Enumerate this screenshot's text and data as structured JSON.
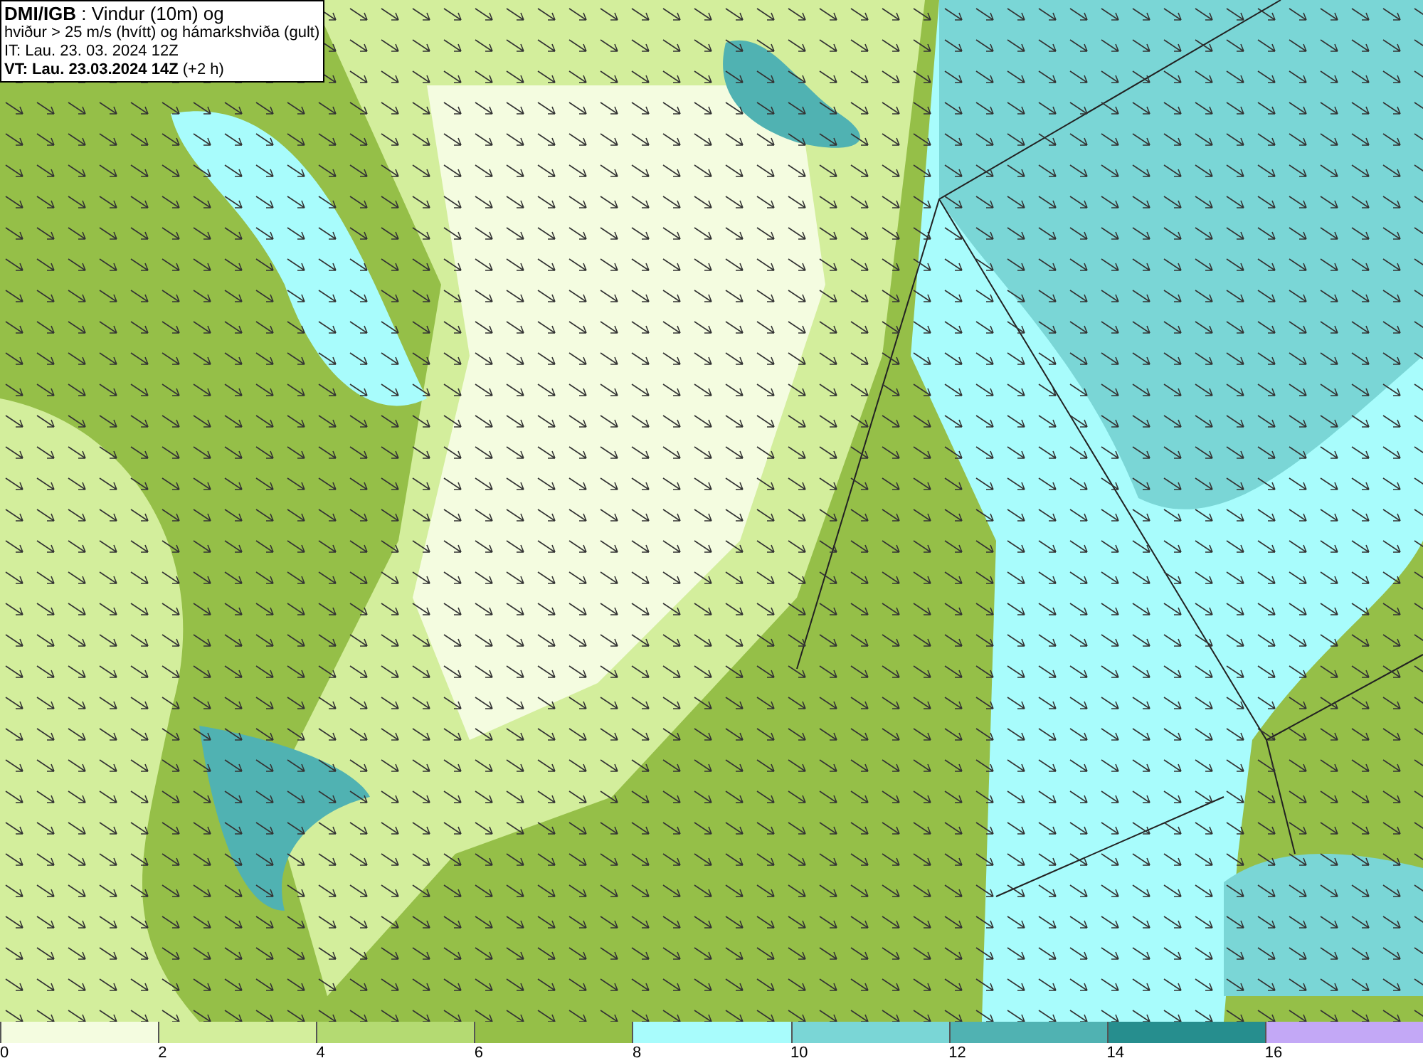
{
  "title_box": {
    "lines": [
      "**DMI/IGB** : Vindur (10m) og",
      "hviður > 25 m/s (hvítt) og hámarkshviða (gult)",
      "IT: Lau. 23. 03. 2024 12Z",
      "**VT: Lau. 23.03.2024 14Z** (+2 h)"
    ]
  },
  "legend": [
    {
      "label": "0",
      "color": "#f4fce0"
    },
    {
      "label": "2",
      "color": "#d3ee9c"
    },
    {
      "label": "4",
      "color": "#b4da72"
    },
    {
      "label": "6",
      "color": "#95bf48"
    },
    {
      "label": "8",
      "color": "#a8fcfc"
    },
    {
      "label": "10",
      "color": "#7ad6d6"
    },
    {
      "label": "12",
      "color": "#50b2b2"
    },
    {
      "label": "14",
      "color": "#268e8e"
    },
    {
      "label": "16",
      "color": "#c3a8f6"
    }
  ]
}
